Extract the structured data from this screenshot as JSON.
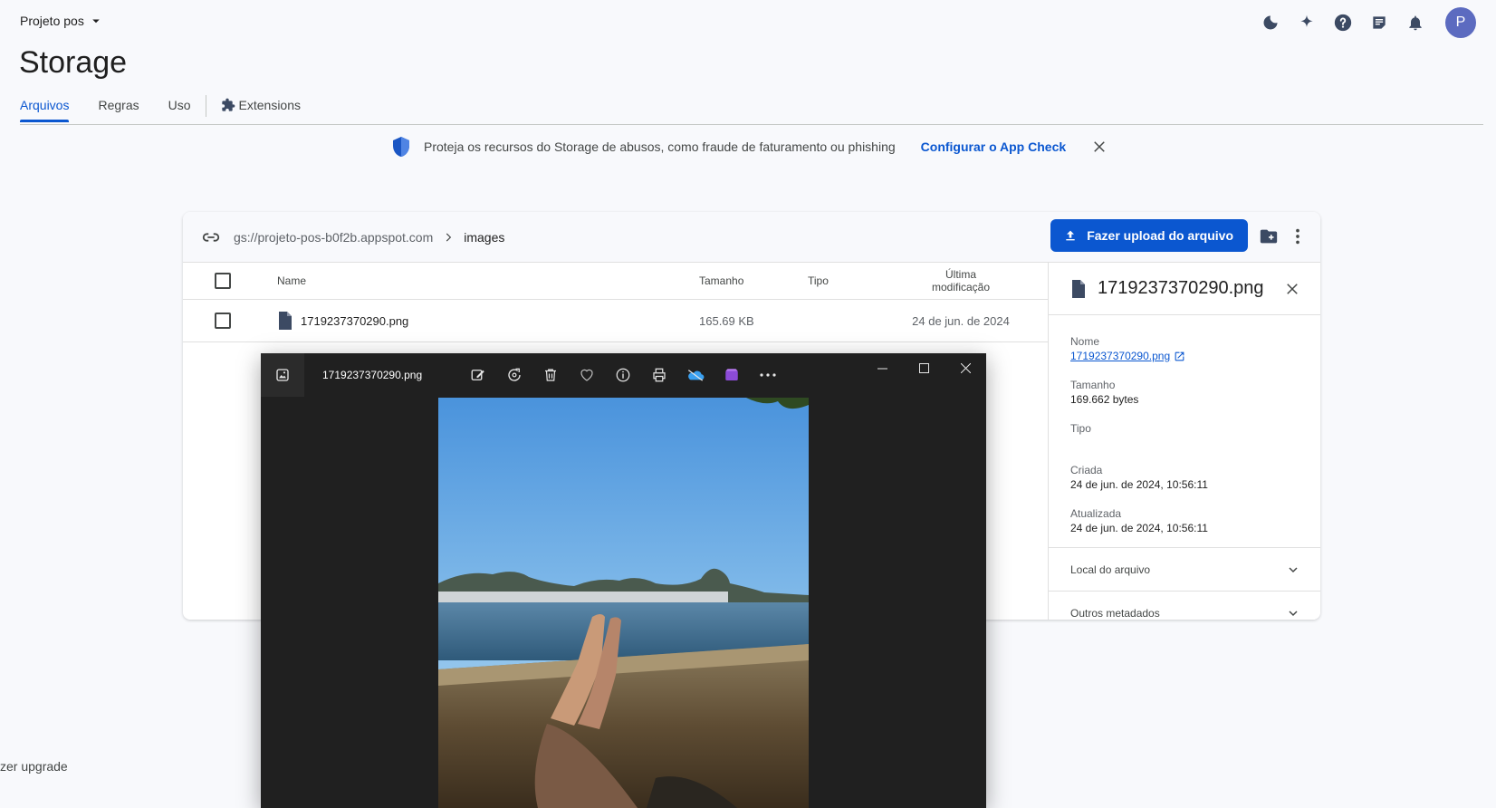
{
  "header": {
    "project": "Projeto pos",
    "avatar_letter": "P",
    "icons": [
      "moon-icon",
      "sparkle-icon",
      "help-icon",
      "notes-icon",
      "bell-icon"
    ]
  },
  "page": {
    "title": "Storage"
  },
  "tabs": [
    {
      "label": "Arquivos",
      "active": true
    },
    {
      "label": "Regras"
    },
    {
      "label": "Uso"
    },
    {
      "label": "Extensions"
    }
  ],
  "banner": {
    "text": "Proteja os recursos do Storage de abusos, como fraude de faturamento ou phishing",
    "link": "Configurar o App Check"
  },
  "storage": {
    "bucket": "gs://projeto-pos-b0f2b.appspot.com",
    "folder": "images",
    "upload_label": "Fazer upload do arquivo",
    "columns": {
      "name": "Name",
      "size": "Tamanho",
      "type": "Tipo",
      "modified_1": "Última",
      "modified_2": "modificação"
    },
    "rows": [
      {
        "name": "1719237370290.png",
        "size": "165.69 KB",
        "type": "",
        "modified": "24 de jun. de 2024"
      }
    ]
  },
  "details": {
    "title": "1719237370290.png",
    "name_label": "Nome",
    "name_value": "1719237370290.png",
    "size_label": "Tamanho",
    "size_value": "169.662 bytes",
    "type_label": "Tipo",
    "created_label": "Criada",
    "created_value": "24 de jun. de 2024, 10:56:11",
    "updated_label": "Atualizada",
    "updated_value": "24 de jun. de 2024, 10:56:11",
    "section_location": "Local do arquivo",
    "section_metadata": "Outros metadados"
  },
  "sidebar": {
    "upgrade_text": "zer upgrade"
  },
  "viewer": {
    "file_name": "1719237370290.png",
    "tools": [
      "edit-image-icon",
      "rotate-icon",
      "delete-icon",
      "favorite-icon",
      "info-icon",
      "print-icon",
      "onedrive-icon",
      "clipchamp-icon",
      "more-icon"
    ]
  },
  "colors": {
    "accent": "#0b57d0",
    "background": "#f8f9fc",
    "viewer_bg": "#202020",
    "avatar": "#5c6bc0"
  }
}
